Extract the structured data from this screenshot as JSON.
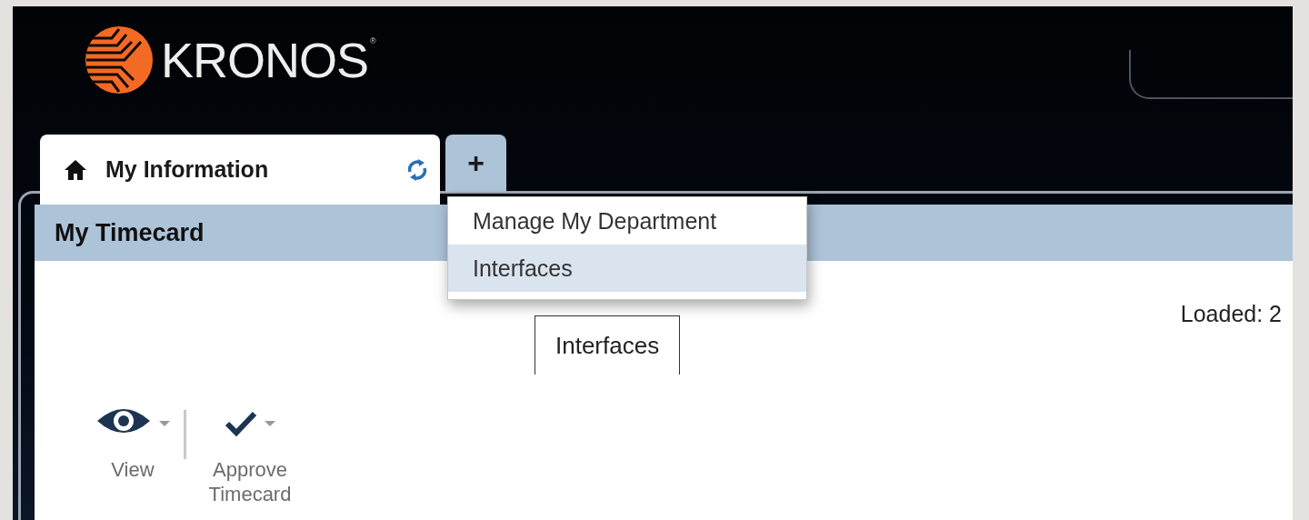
{
  "logo": {
    "wordmark": "KRONOS",
    "registered_mark": "®"
  },
  "tabs": [
    {
      "kind": "workspace",
      "label": "My Information",
      "selected": true
    },
    {
      "kind": "add",
      "label": "+",
      "selected": false
    }
  ],
  "menu": {
    "items": [
      {
        "label": "Manage My Department",
        "selected": false
      },
      {
        "label": "Interfaces",
        "selected": true
      }
    ]
  },
  "panel": {
    "title": "My Timecard",
    "loaded_text": "Loaded: 2",
    "tab_label": "Interfaces",
    "toolbar": [
      {
        "kind": "view",
        "label": "View"
      },
      {
        "kind": "approve",
        "label": "Approve Timecard"
      }
    ]
  }
}
